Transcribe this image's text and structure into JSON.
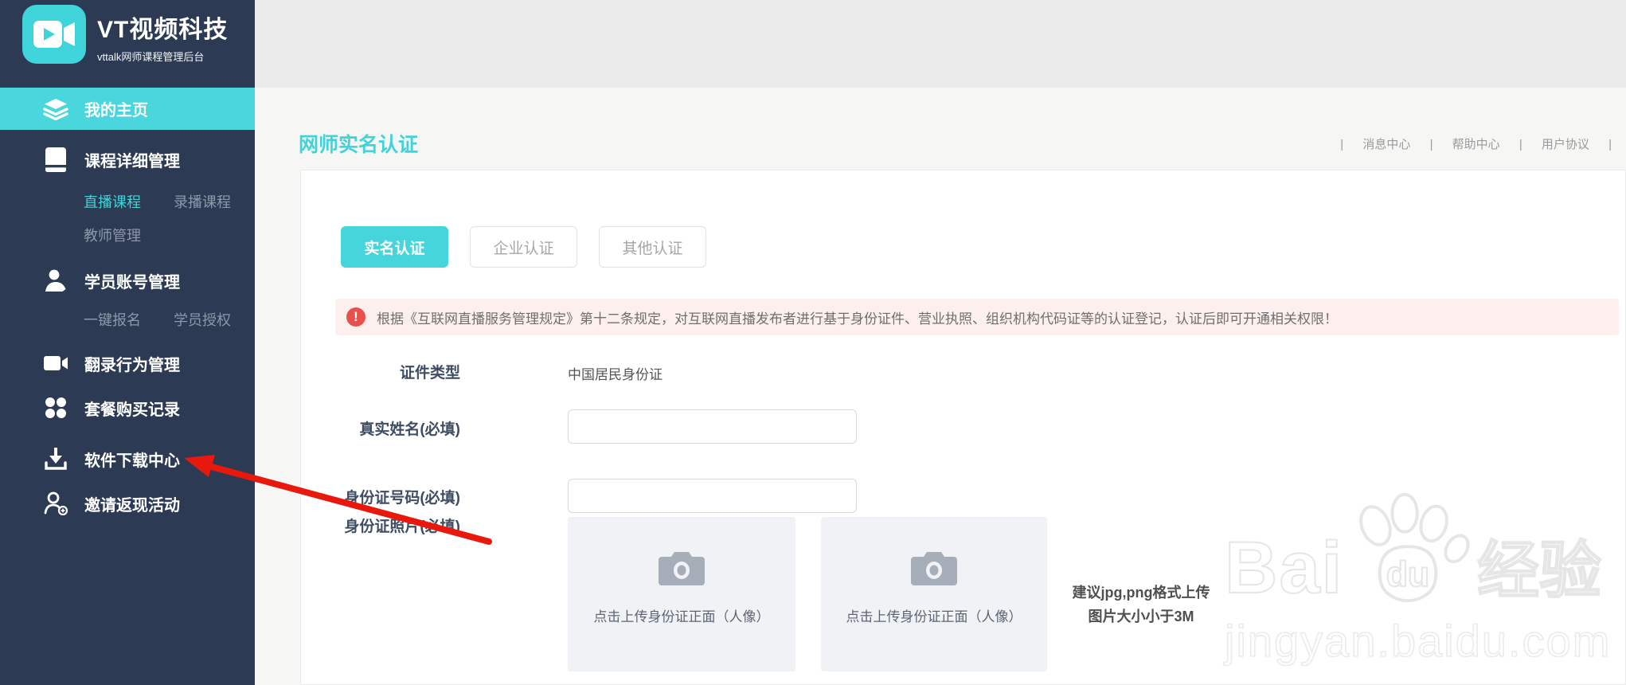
{
  "brand": {
    "title": "VT视频科技",
    "subtitle": "vttalk网师课程管理后台"
  },
  "topbar": {
    "sep": "|",
    "links": [
      {
        "label": "消息中心"
      },
      {
        "label": "帮助中心"
      },
      {
        "label": "用户协议"
      }
    ]
  },
  "sidebar": {
    "items": [
      {
        "label": "我的主页",
        "icon": "layers-icon",
        "active": true
      },
      {
        "label": "课程详细管理",
        "icon": "book-icon"
      },
      {
        "label": "学员账号管理",
        "icon": "user-icon"
      },
      {
        "label": "翻录行为管理",
        "icon": "video-camera-icon"
      },
      {
        "label": "套餐购买记录",
        "icon": "grid-icon"
      },
      {
        "label": "软件下载中心",
        "icon": "download-icon"
      },
      {
        "label": "邀请返现活动",
        "icon": "user-plus-icon"
      }
    ],
    "course_sub": [
      "直播课程",
      "录播课程",
      "教师管理"
    ],
    "student_sub": [
      "一键报名",
      "学员授权"
    ]
  },
  "page": {
    "title": "网师实名认证"
  },
  "tabs": [
    {
      "label": "实名认证",
      "active": true
    },
    {
      "label": "企业认证",
      "active": false
    },
    {
      "label": "其他认证",
      "active": false
    }
  ],
  "alert": {
    "icon": "exclamation-circle-icon",
    "text": "根据《互联网直播服务管理规定》第十二条规定，对互联网直播发布者进行基于身份证件、营业执照、组织机构代码证等的认证登记，认证后即可开通相关权限！"
  },
  "form": {
    "cert_type": {
      "label": "证件类型",
      "value": "中国居民身份证"
    },
    "real_name": {
      "label": "真实姓名(必填)",
      "value": ""
    },
    "id_number": {
      "label": "身份证号码(必填)",
      "value": ""
    },
    "id_photo": {
      "label": "身份证照片(必填)"
    },
    "upload_front": {
      "icon": "camera-icon",
      "text": "点击上传身份证正面（人像）"
    },
    "upload_back": {
      "icon": "camera-icon",
      "text": "点击上传身份证正面（人像）"
    },
    "upload_hint": {
      "line1": "建议jpg,png格式上传",
      "line2": "图片大小小于3M"
    }
  },
  "watermark": {
    "text1": "Bai",
    "text2": "du",
    "text3": "经验",
    "url": "jingyan.baidu.com"
  },
  "colors": {
    "accent": "#46d5db",
    "sidebar_bg": "#2c3a53",
    "active_item_bg": "#4ad6dd",
    "title_teal": "#41d3da",
    "alert_bg": "#fdefee",
    "alert_icon": "#e8504c",
    "arrow_red": "#e8190c",
    "header_band": "#ecebeb"
  }
}
